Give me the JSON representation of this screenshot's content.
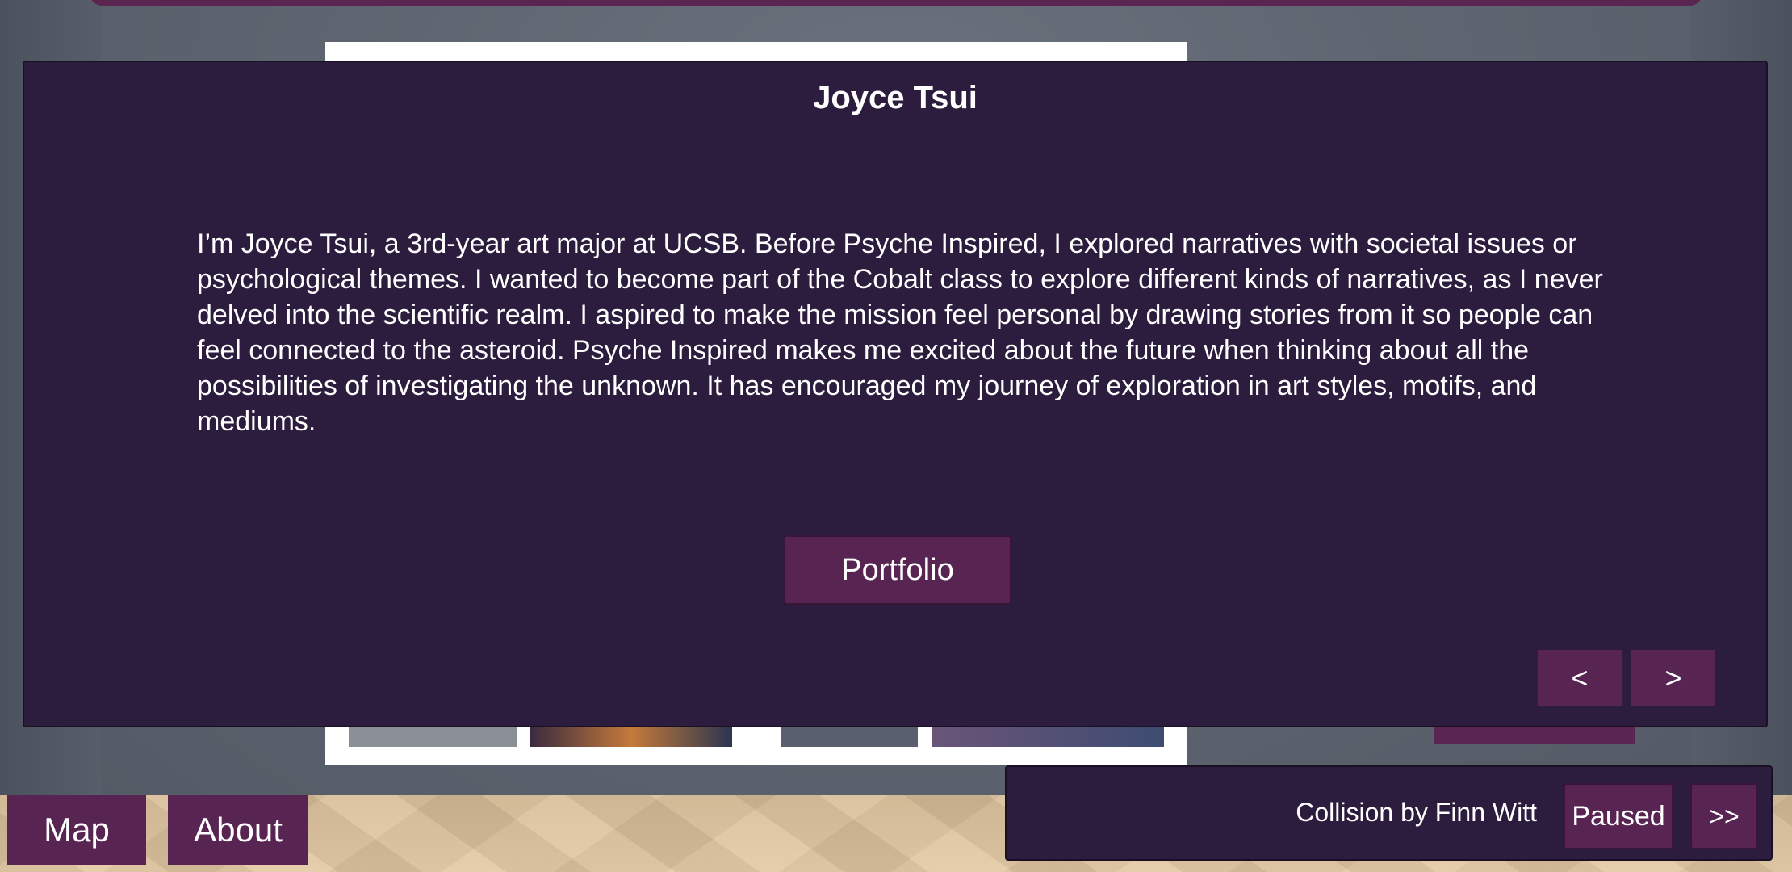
{
  "modal": {
    "title": "Joyce Tsui",
    "bio": "I’m Joyce Tsui, a 3rd-year art major at UCSB. Before Psyche Inspired, I explored narratives with societal issues or psychological themes. I wanted to become part of the Cobalt class to explore different kinds of narratives, as I never delved into the scientific realm. I aspired to make the mission feel personal by drawing stories from it so people can feel connected to the asteroid. Psyche Inspired makes me excited about the future when thinking about all the possibilities of investigating the unknown. It has encouraged my journey of exploration in art styles, motifs, and mediums.",
    "portfolio_label": "Portfolio",
    "prev_label": "<",
    "next_label": ">"
  },
  "nav": {
    "map_label": "Map",
    "about_label": "About"
  },
  "music": {
    "track": "Collision by Finn Witt",
    "pause_label": "Paused",
    "skip_label": ">>"
  },
  "colors": {
    "panel_background": "#2c1c3d",
    "button_accent": "#582553",
    "text": "#ffffff"
  }
}
